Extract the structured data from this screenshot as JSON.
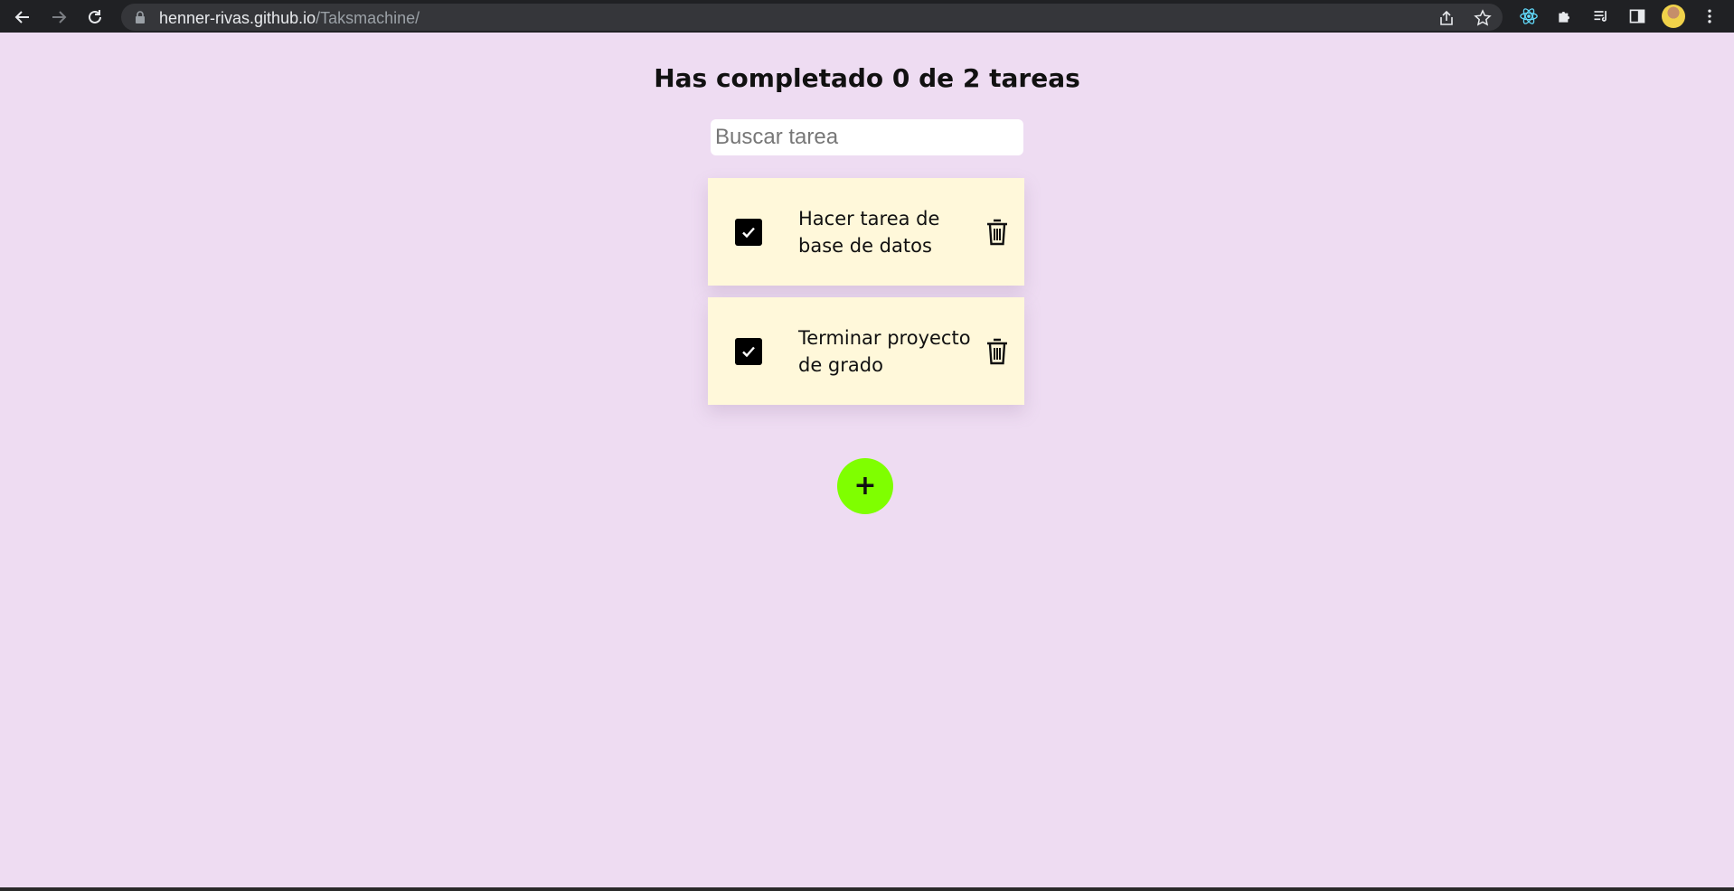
{
  "browser": {
    "url_host": "henner-rivas.github.io",
    "url_path": "/Taksmachine/"
  },
  "app": {
    "title": "Has completado 0 de 2 tareas",
    "search_placeholder": "Buscar tarea",
    "search_value": "",
    "todos": [
      {
        "text": "Hacer tarea de base de datos",
        "checked": true
      },
      {
        "text": "Terminar proyecto de grado",
        "checked": true
      }
    ],
    "add_button_label": "+"
  },
  "colors": {
    "background": "#eedcf2",
    "todo_card": "#fff8da",
    "add_button": "#7fff00",
    "browser_bar": "#202124"
  }
}
